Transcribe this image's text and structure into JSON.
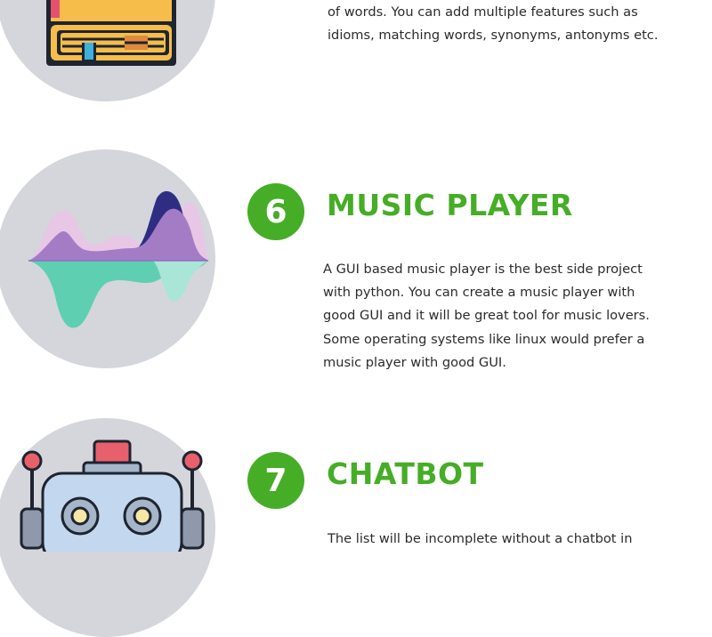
{
  "colors": {
    "accent": "#46ad27",
    "circle_bg": "#d4d6dc",
    "text": "#2b2b2b"
  },
  "section5": {
    "icon": "dictionary-book-icon",
    "text_lines": [
      "of words. You can add multiple features such as",
      "idioms, matching words, synonyms, antonyms etc."
    ]
  },
  "section6": {
    "number": "6",
    "title": "MUSIC PLAYER",
    "icon": "sound-wave-icon",
    "text_lines": [
      "A GUI based music player is the best side project",
      "with python. You can create a music player with",
      "good GUI and it will be great tool for music lovers.",
      "Some operating systems like linux would prefer a",
      "music player with good GUI."
    ]
  },
  "section7": {
    "number": "7",
    "title": "CHATBOT",
    "icon": "robot-icon",
    "text_lines": [
      "The list will be incomplete without a chatbot in"
    ]
  }
}
